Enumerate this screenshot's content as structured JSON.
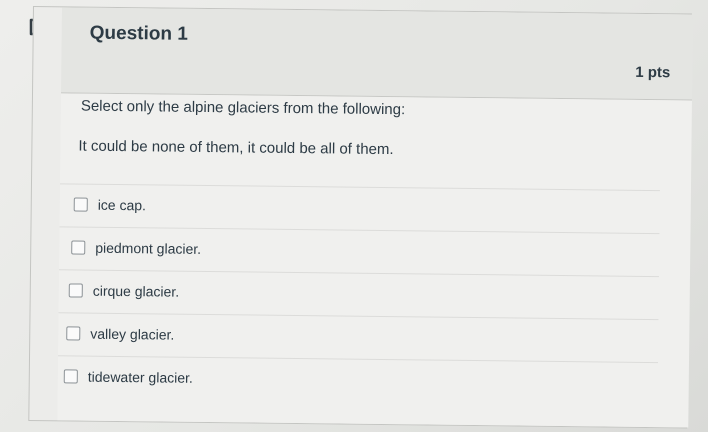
{
  "question": {
    "title": "Question 1",
    "points": "1 pts",
    "prompt": "Select only the alpine glaciers from the following:",
    "note": "It could be none of them, it could be all of them.",
    "flag_icon": "flag-outline-icon",
    "answers": [
      {
        "label": "ice cap.",
        "checked": false
      },
      {
        "label": "piedmont glacier.",
        "checked": false
      },
      {
        "label": "cirque glacier.",
        "checked": false
      },
      {
        "label": "valley glacier.",
        "checked": false
      },
      {
        "label": "tidewater glacier.",
        "checked": false
      }
    ]
  },
  "colors": {
    "text": "#2d3b45",
    "border": "#c4c5c2",
    "flag": "#333d44"
  }
}
